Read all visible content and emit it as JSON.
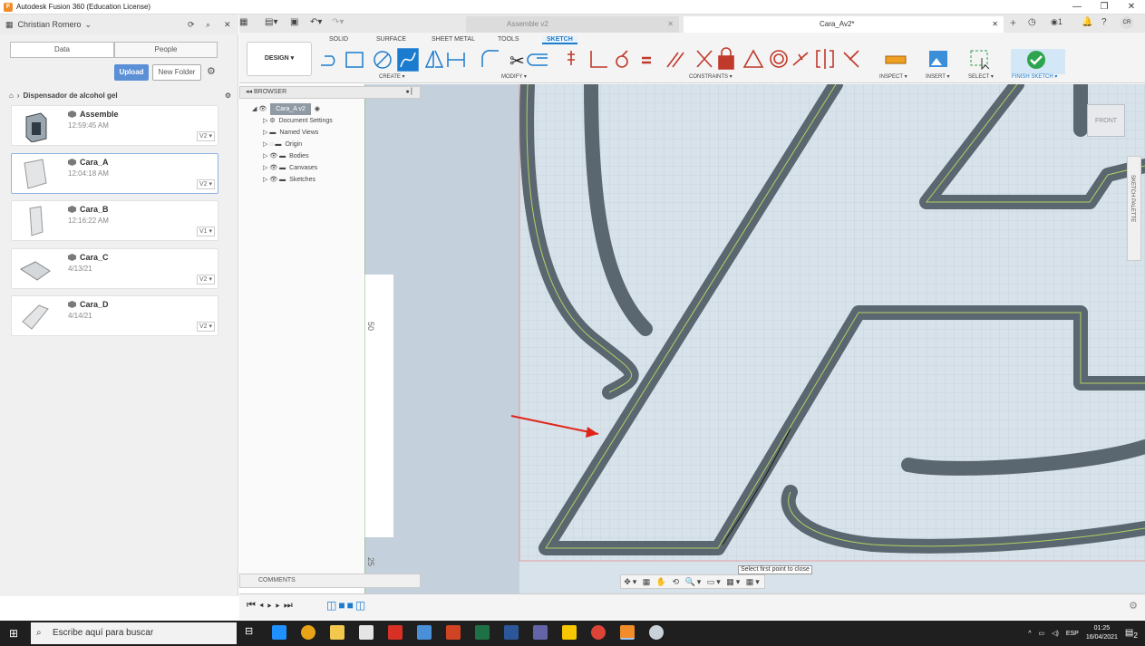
{
  "window": {
    "title": "Autodesk Fusion 360 (Education License)",
    "minimize": "—",
    "maximize": "❐",
    "close": "✕"
  },
  "datapanel": {
    "user": "Christian Romero",
    "tabs": [
      "Data",
      "People"
    ],
    "upload": "Upload",
    "new_folder": "New Folder",
    "breadcrumb": "Dispensador de alcohol gel",
    "items": [
      {
        "name": "Assemble",
        "date": "12:59:45 AM",
        "version": "V2 ▾"
      },
      {
        "name": "Cara_A",
        "date": "12:04:18 AM",
        "version": "V2 ▾"
      },
      {
        "name": "Cara_B",
        "date": "12:16:22 AM",
        "version": "V1 ▾"
      },
      {
        "name": "Cara_C",
        "date": "4/13/21",
        "version": "V2 ▾"
      },
      {
        "name": "Cara_D",
        "date": "4/14/21",
        "version": "V2 ▾"
      }
    ]
  },
  "doctabs": [
    {
      "label": "Assemble v2"
    },
    {
      "label": "Cara_Av2*"
    }
  ],
  "user_initials": "CR",
  "jobs_count": "1",
  "ribbon": {
    "tabs": [
      "SOLID",
      "SURFACE",
      "SHEET METAL",
      "TOOLS",
      "SKETCH"
    ],
    "workspace": "DESIGN ▾",
    "groups": [
      "CREATE ▾",
      "MODIFY ▾",
      "CONSTRAINTS ▾",
      "INSPECT ▾",
      "INSERT ▾",
      "SELECT ▾",
      "FINISH SKETCH ▾"
    ]
  },
  "browser": {
    "title": "BROWSER",
    "root": "Cara_A v2",
    "items": [
      "Document Settings",
      "Named Views",
      "Origin",
      "Bodies",
      "Canvases",
      "Sketches"
    ],
    "comments": "COMMENTS"
  },
  "canvas": {
    "dim_50": "50",
    "dim_25": "25",
    "status_hint": "Select first point to close",
    "viewcube": "FRONT",
    "palette": "SKETCH PALETTE",
    "nav_icons": "✥▾ ▦ ✋ ⟲ 🔍▾ ▭▾ ▦▾ ▦▾"
  },
  "taskbar": {
    "search": "Escribe aquí para buscar",
    "lang": "ESP",
    "time": "01:25",
    "date": "16/04/2021",
    "notif_count": "2"
  },
  "colors": {
    "accent": "#1b7ccf",
    "path_fill": "#5b6770",
    "canvas_bg": "#c7d4de",
    "finish_green": "#2ea44f",
    "arrow": "#e0241a"
  }
}
